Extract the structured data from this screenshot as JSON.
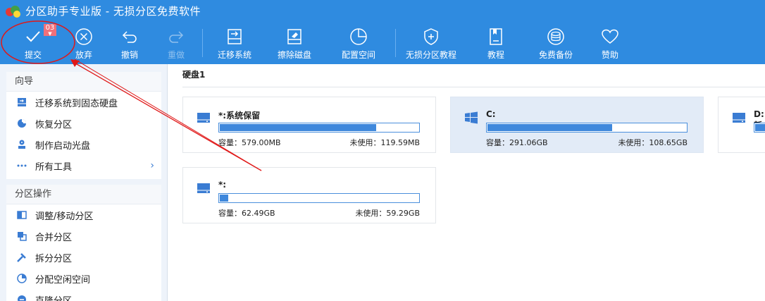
{
  "window": {
    "title": "分区助手专业版 - 无损分区免费软件"
  },
  "colors": {
    "toolbar_bg": "#2f8be0",
    "accent": "#3f88dc",
    "annotation": "#e01818",
    "badge": "#f0707a"
  },
  "toolbar": {
    "submit": {
      "label": "提交",
      "badge": "03",
      "icon": "checkmark-icon"
    },
    "discard": {
      "label": "放弃",
      "icon": "circle-x-icon"
    },
    "undo": {
      "label": "撤销",
      "icon": "undo-icon"
    },
    "redo": {
      "label": "重做",
      "icon": "redo-icon"
    },
    "migrate": {
      "label": "迁移系统",
      "icon": "drive-arrow-icon"
    },
    "wipe": {
      "label": "擦除磁盘",
      "icon": "eraser-icon"
    },
    "allocate": {
      "label": "配置空间",
      "icon": "pie-icon"
    },
    "tutorial": {
      "label": "无损分区教程",
      "icon": "shield-plus-icon"
    },
    "guide": {
      "label": "教程",
      "icon": "book-icon"
    },
    "backup": {
      "label": "免费备份",
      "icon": "database-icon"
    },
    "donate": {
      "label": "赞助",
      "icon": "heart-icon"
    }
  },
  "sidebar": {
    "wizard": {
      "title": "向导",
      "items": [
        {
          "label": "迁移系统到固态硬盘"
        },
        {
          "label": "恢复分区"
        },
        {
          "label": "制作启动光盘"
        },
        {
          "label": "所有工具"
        }
      ]
    },
    "partition_ops": {
      "title": "分区操作",
      "items": [
        {
          "label": "调整/移动分区"
        },
        {
          "label": "合并分区"
        },
        {
          "label": "拆分分区"
        },
        {
          "label": "分配空闲空间"
        },
        {
          "label": "克隆分区"
        }
      ]
    }
  },
  "main": {
    "disk_label": "硬盘1",
    "partitions": [
      {
        "name": "*:系统保留",
        "capacity": "容量：579.00MB",
        "free": "未使用：119.59MB",
        "used_fraction": 0.79
      },
      {
        "name": "C:",
        "capacity": "容量：291.06GB",
        "free": "未使用：108.65GB",
        "used_fraction": 0.63
      },
      {
        "name": "D:新",
        "used_fraction": 0.6
      },
      {
        "name": "*:",
        "capacity": "容量：62.49GB",
        "free": "未使用：59.29GB",
        "used_fraction": 0.05
      }
    ]
  }
}
